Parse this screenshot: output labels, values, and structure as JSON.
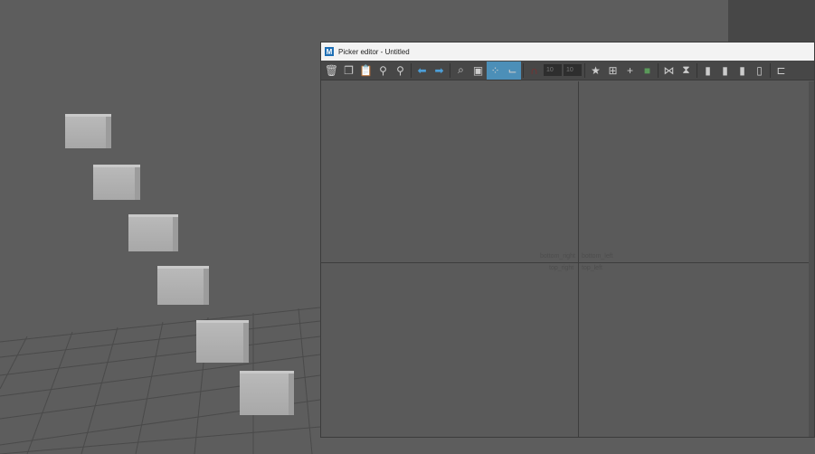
{
  "window": {
    "title": "Picker editor - Untitled",
    "logo": "M"
  },
  "toolbar": {
    "icons": [
      "trash-icon",
      "copy-icon",
      "paste-icon",
      "search-minus-icon",
      "search-plus-icon",
      "arrow-left-icon",
      "arrow-right-icon",
      "zoom-icon",
      "snapshot-icon",
      "snap-grid-icon",
      "snap-icon",
      "magnet-icon",
      "star-icon",
      "add-button-icon",
      "add-text-icon",
      "add-background-icon",
      "mirror-h-icon",
      "mirror-v-icon",
      "layer-back-icon",
      "layer-down-icon",
      "layer-up-icon",
      "layer-front-icon",
      "align-left-icon"
    ],
    "grid_x": "10",
    "grid_y": "10"
  },
  "canvas": {
    "labels": {
      "bottom_right": "bottom_right",
      "bottom_left": "bottom_left",
      "top_right": "top_right",
      "top_left": "top_left"
    }
  },
  "colors": {
    "accent": "#4c8fb8",
    "background": "#5d5d5d"
  }
}
